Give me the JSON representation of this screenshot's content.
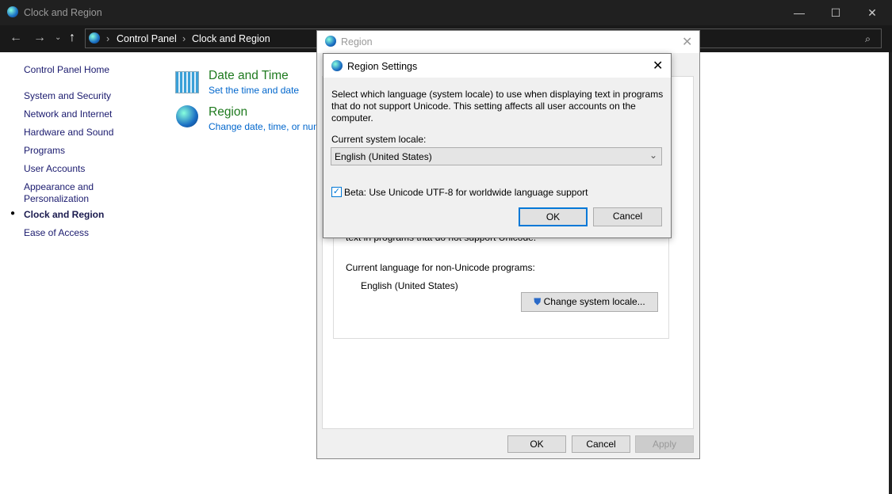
{
  "window": {
    "title": "Clock and Region",
    "controls": [
      "—",
      "☐",
      "✕"
    ]
  },
  "address": {
    "breadcrumb": [
      "Control Panel",
      "Clock and Region"
    ]
  },
  "sidebar": {
    "home": "Control Panel Home",
    "items": [
      "System and Security",
      "Network and Internet",
      "Hardware and Sound",
      "Programs",
      "User Accounts",
      "Appearance and Personalization",
      "Clock and Region",
      "Ease of Access"
    ],
    "active": "Clock and Region"
  },
  "categories": [
    {
      "title": "Date and Time",
      "link": "Set the time and date"
    },
    {
      "title": "Region",
      "link": "Change date, time, or num"
    }
  ],
  "region_dialog": {
    "title": "Region",
    "partial_text": "text in programs that do not support Unicode.",
    "current_label": "Current language for non-Unicode programs:",
    "current_value": "English (United States)",
    "change_button": "Change system locale...",
    "ok": "OK",
    "cancel": "Cancel",
    "apply": "Apply"
  },
  "region_settings": {
    "title": "Region Settings",
    "description": "Select which language (system locale) to use when displaying text in programs that do not support Unicode. This setting affects all user accounts on the computer.",
    "locale_label": "Current system locale:",
    "locale_value": "English (United States)",
    "beta_label": "Beta: Use Unicode UTF-8 for worldwide language support",
    "beta_checked": true,
    "ok": "OK",
    "cancel": "Cancel"
  },
  "colors": {
    "accent": "#0078d7",
    "category": "#1f7a1f",
    "link": "#0066cc"
  }
}
